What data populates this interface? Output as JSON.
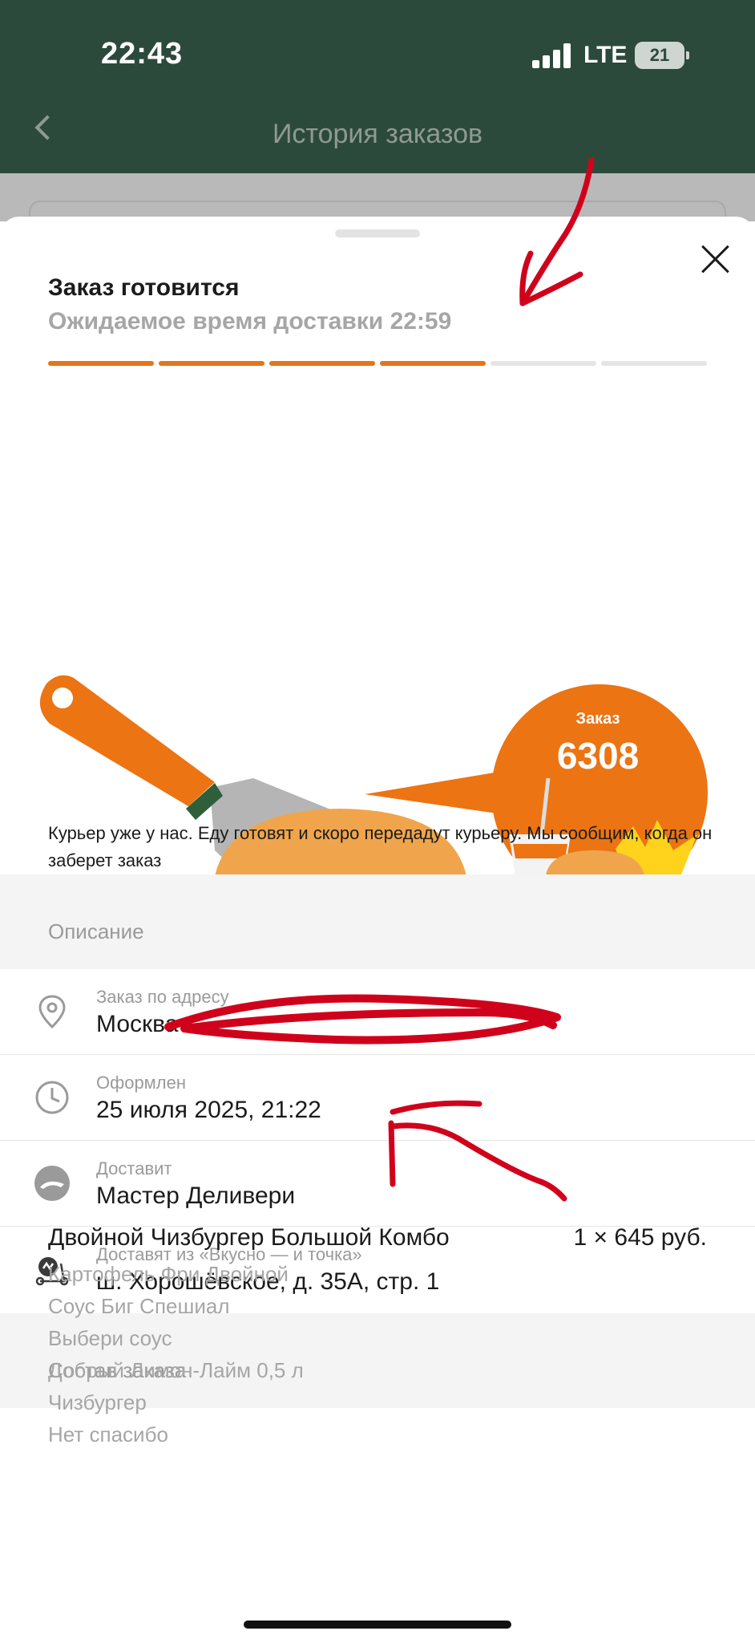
{
  "status_bar": {
    "time": "22:43",
    "network": "LTE",
    "battery": "21"
  },
  "nav": {
    "title": "История заказов"
  },
  "order": {
    "status": "Заказ готовится",
    "eta": "Ожидаемое время доставки 22:59",
    "progress_total": 6,
    "progress_done": 4,
    "badge_label": "Заказ",
    "number": "6308",
    "message": "Курьер уже у нас. Еду готовят и скоро передадут курьеру. Мы сообщим, когда он заберет заказ"
  },
  "description": {
    "title": "Описание",
    "rows": [
      {
        "icon": "location-pin-icon",
        "label": "Заказ по адресу",
        "value": "Москва"
      },
      {
        "icon": "clock-icon",
        "label": "Оформлен",
        "value": "25 июля 2025, 21:22"
      },
      {
        "icon": "delivery-service-icon",
        "label": "Доставит",
        "value": "Мастер Деливери"
      },
      {
        "icon": "courier-scooter-icon",
        "label": "Доставят из «Вкусно — и точка»",
        "value": "ш. Хорошёвское, д. 35А, стр. 1"
      }
    ]
  },
  "composition": {
    "title": "Состав заказа",
    "item": {
      "name": "Двойной Чизбургер Большой Комбо",
      "price": "1 × 645 руб.",
      "components": [
        "Картофель Фри Двойной",
        "Соус Биг Спешиал",
        "Выбери соус",
        "Добрый Лимон-Лайм 0,5 л",
        "Чизбургер",
        "Нет спасибо"
      ]
    }
  },
  "colors": {
    "accent": "#e5741a",
    "header": "#2c4a3b",
    "annotation": "#d0021b"
  }
}
